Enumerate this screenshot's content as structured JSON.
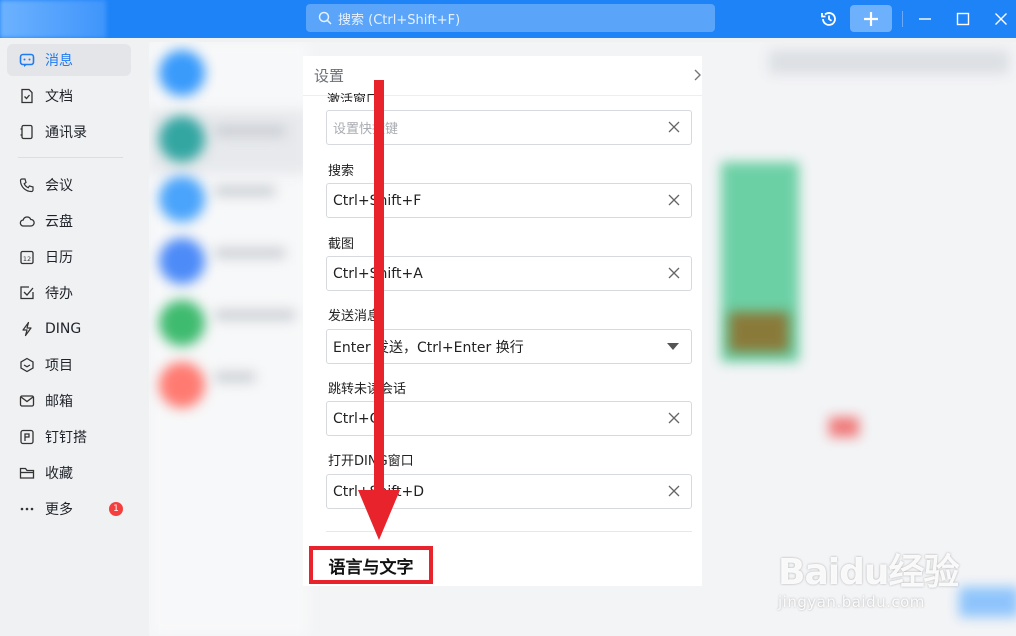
{
  "titlebar": {
    "search_placeholder": "搜索 (Ctrl+Shift+F)"
  },
  "sidebar": {
    "items": [
      {
        "label": "消息",
        "icon": "chat-icon",
        "active": true
      },
      {
        "label": "文档",
        "icon": "doc-icon"
      },
      {
        "label": "通讯录",
        "icon": "contacts-icon"
      },
      {
        "label": "会议",
        "icon": "phone-icon"
      },
      {
        "label": "云盘",
        "icon": "cloud-icon"
      },
      {
        "label": "日历",
        "icon": "calendar-icon"
      },
      {
        "label": "待办",
        "icon": "todo-icon"
      },
      {
        "label": "DING",
        "icon": "lightning-icon"
      },
      {
        "label": "项目",
        "icon": "project-icon"
      },
      {
        "label": "邮箱",
        "icon": "mail-icon"
      },
      {
        "label": "钉钉搭",
        "icon": "builder-icon"
      },
      {
        "label": "收藏",
        "icon": "folder-icon"
      },
      {
        "label": "更多",
        "icon": "more-icon",
        "badge": "1"
      }
    ],
    "calendar_icon_num": "12"
  },
  "settings": {
    "title": "设置",
    "cut_label": "激活窗口",
    "fields": [
      {
        "label": "",
        "value": "设置快捷键",
        "placeholder": true,
        "control": "clear"
      },
      {
        "label": "搜索",
        "value": "Ctrl+Shift+F",
        "control": "clear"
      },
      {
        "label": "截图",
        "value": "Ctrl+Shift+A",
        "control": "clear"
      },
      {
        "label": "发送消息",
        "value": "Enter 发送，Ctrl+Enter 换行",
        "control": "dropdown"
      },
      {
        "label": "跳转未读会话",
        "value": "Ctrl+G",
        "control": "clear"
      },
      {
        "label": "打开DING窗口",
        "value": "Ctrl+Shift+D",
        "control": "clear"
      }
    ],
    "section_title": "语言与文字"
  },
  "watermark": {
    "logo": "Baidu经验",
    "url": "jingyan.baidu.com"
  },
  "colors": {
    "titlebar": "#1e83f7",
    "accent": "#1e7bf2",
    "annotation_red": "#e8232b",
    "badge_red": "#f53f3f"
  }
}
